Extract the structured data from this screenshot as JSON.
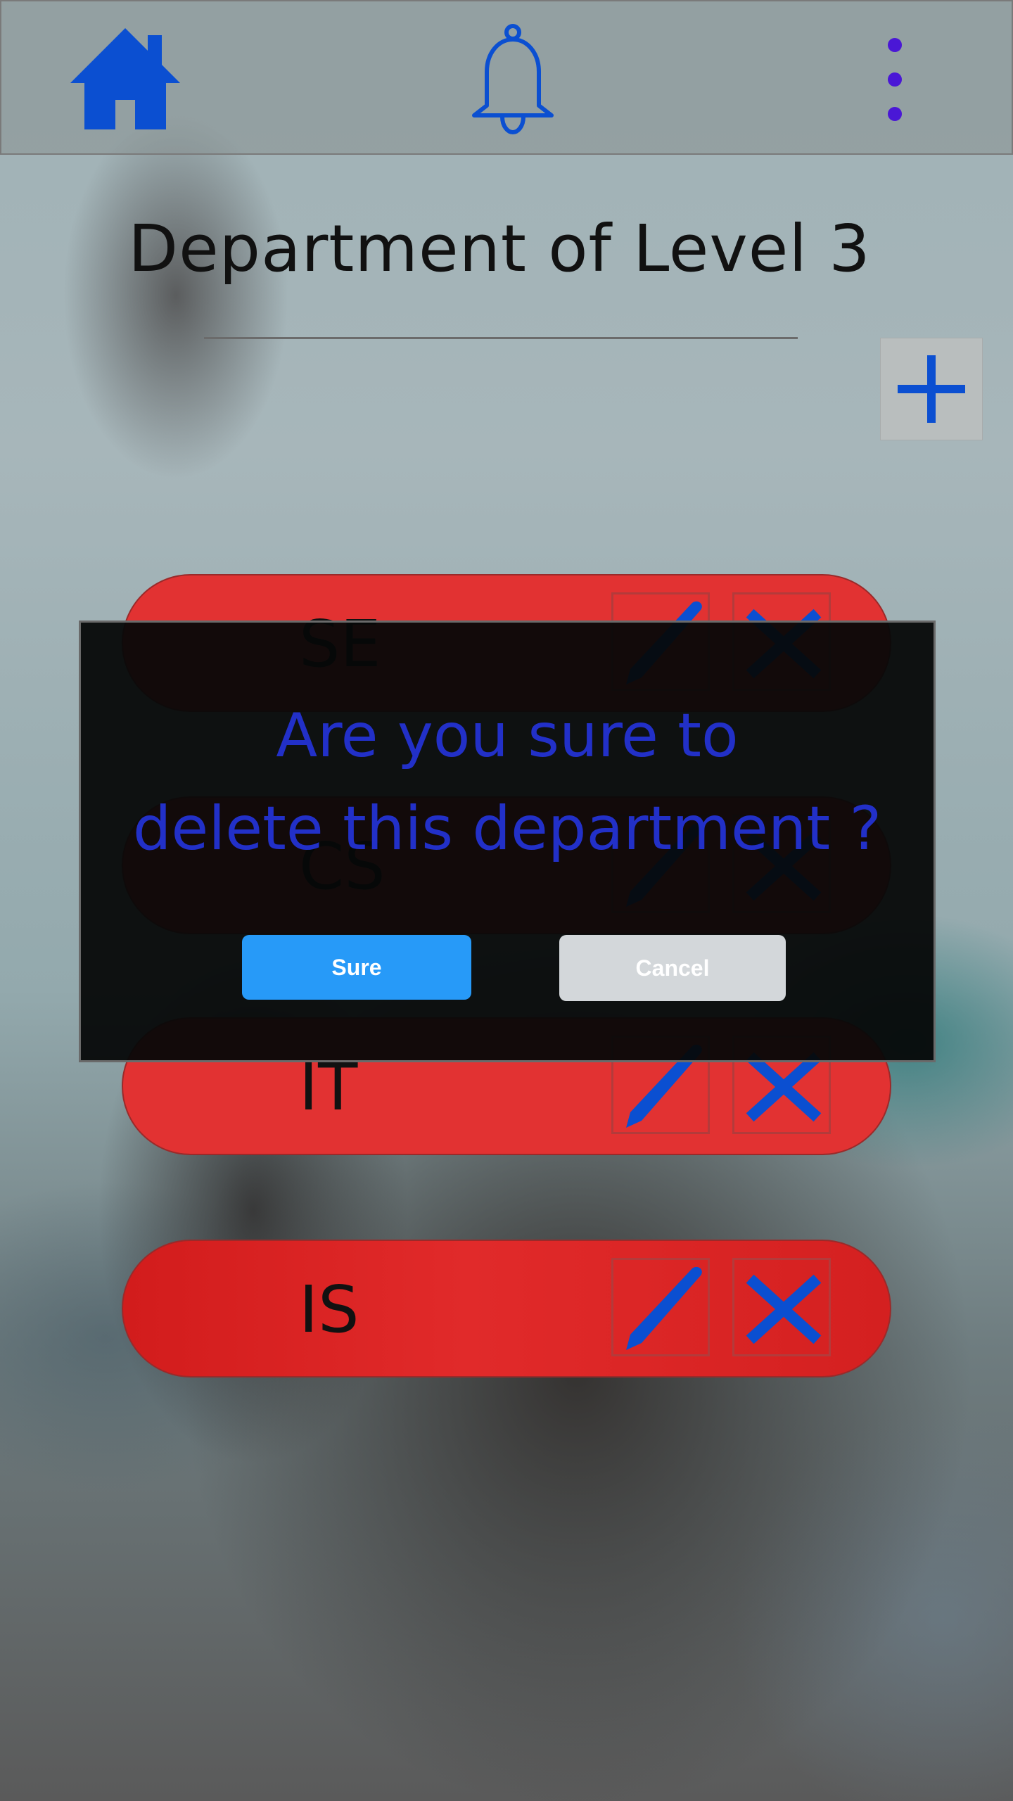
{
  "header": {
    "home_icon": "home-icon",
    "bell_icon": "bell-icon",
    "more_icon": "more-vertical-icon"
  },
  "page": {
    "title": "Department of Level 3",
    "add_icon": "plus-icon"
  },
  "departments": [
    {
      "name": "SE"
    },
    {
      "name": "CS"
    },
    {
      "name": "IT"
    },
    {
      "name": "IS"
    }
  ],
  "dialog": {
    "message": "Are you sure to delete this department ?",
    "sure_label": "Sure",
    "cancel_label": "Cancel"
  },
  "colors": {
    "accent_blue": "#0b4fd1",
    "row_red": "#e23232",
    "dialog_text": "#2230c8",
    "sure_button": "#279af8",
    "cancel_button": "#d3d7da"
  }
}
